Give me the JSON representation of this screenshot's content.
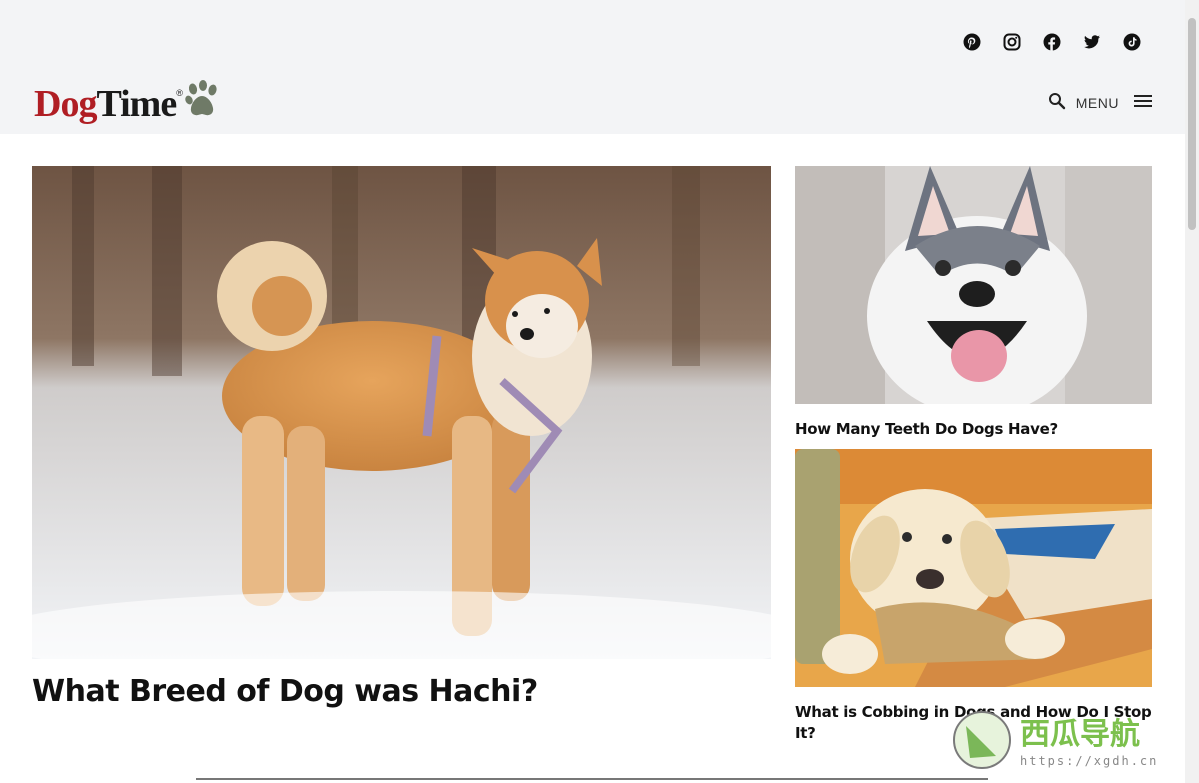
{
  "site": {
    "logo_part1": "Dog",
    "logo_part2": "Time",
    "logo_reg": "®",
    "brand_red": "#b01e24"
  },
  "social": [
    "pinterest-icon",
    "instagram-icon",
    "facebook-icon",
    "twitter-icon",
    "tiktok-icon"
  ],
  "nav": {
    "menu_label": "MENU"
  },
  "feature": {
    "title": "What Breed of Dog was Hachi?",
    "image": "akita-dog-in-snow"
  },
  "side_articles": [
    {
      "title": "How Many Teeth Do Dogs Have?",
      "image": "husky-puppy-smiling"
    },
    {
      "title": "What is Cobbing in Dogs and How Do I Stop It?",
      "image": "lab-puppy-chewing-rug"
    }
  ],
  "watermark": {
    "text_cn": "西瓜导航",
    "text_url": "https://xgdh.cn"
  }
}
